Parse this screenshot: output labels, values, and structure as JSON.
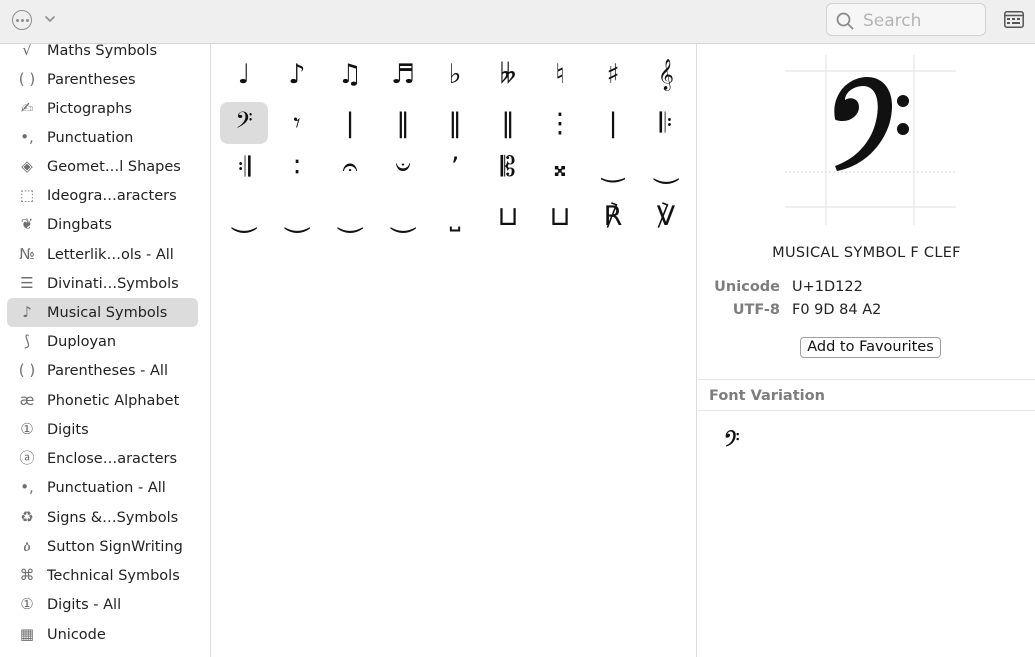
{
  "toolbar": {
    "more_icon": "ellipsis-circle-icon",
    "chevron_icon": "chevron-down-icon",
    "search_placeholder": "Search",
    "view_icon": "keyboard-viewer-icon"
  },
  "sidebar": {
    "items": [
      {
        "icon": "√",
        "label": "Maths Symbols"
      },
      {
        "icon": "( )",
        "label": "Parentheses"
      },
      {
        "icon": "✍",
        "label": "Pictographs"
      },
      {
        "icon": "•,",
        "label": "Punctuation"
      },
      {
        "icon": "◈",
        "label": "Geomet…l Shapes"
      },
      {
        "icon": "⬚",
        "label": "Ideogra…aracters"
      },
      {
        "icon": "❦",
        "label": "Dingbats"
      },
      {
        "icon": "№",
        "label": "Letterlik…ols - All"
      },
      {
        "icon": "☰",
        "label": "Divinati…Symbols"
      },
      {
        "icon": "♪",
        "label": "Musical Symbols",
        "selected": true
      },
      {
        "icon": "⟆",
        "label": "Duployan"
      },
      {
        "icon": "( )",
        "label": "Parentheses - All"
      },
      {
        "icon": "æ",
        "label": "Phonetic Alphabet"
      },
      {
        "icon": "①",
        "label": "Digits"
      },
      {
        "icon": "ⓐ",
        "label": "Enclose…aracters"
      },
      {
        "icon": "•,",
        "label": "Punctuation - All"
      },
      {
        "icon": "♻",
        "label": "Signs &…Symbols"
      },
      {
        "icon": "ዕ",
        "label": "Sutton SignWriting"
      },
      {
        "icon": "⌘",
        "label": "Technical Symbols"
      },
      {
        "icon": "①",
        "label": "Digits - All"
      },
      {
        "icon": "▦",
        "label": "Unicode"
      }
    ]
  },
  "grid": {
    "symbols": [
      "♩",
      "♪",
      "♫",
      "♬",
      "♭",
      "𝄫",
      "♮",
      "♯",
      "𝄞",
      "𝄢",
      "𝄾",
      "|",
      "‖",
      "‖",
      "‖",
      "⋮",
      "|",
      "𝄆",
      "𝄇",
      "∶",
      "𝄐",
      "𝄑",
      "’",
      "𝄡",
      "𝄪",
      "‿",
      "⏝",
      "⏝",
      "⏝",
      "⏝",
      "⏝",
      "⎵",
      "⊔",
      "⊔",
      "℟",
      "℣"
    ],
    "selected_index": 9
  },
  "detail": {
    "char_name": "MUSICAL SYMBOL F CLEF",
    "unicode_label": "Unicode",
    "unicode_value": "U+1D122",
    "utf8_label": "UTF-8",
    "utf8_value": "F0 9D 84 A2",
    "fav_button": "Add to Favourites",
    "font_variation_title": "Font Variation"
  }
}
